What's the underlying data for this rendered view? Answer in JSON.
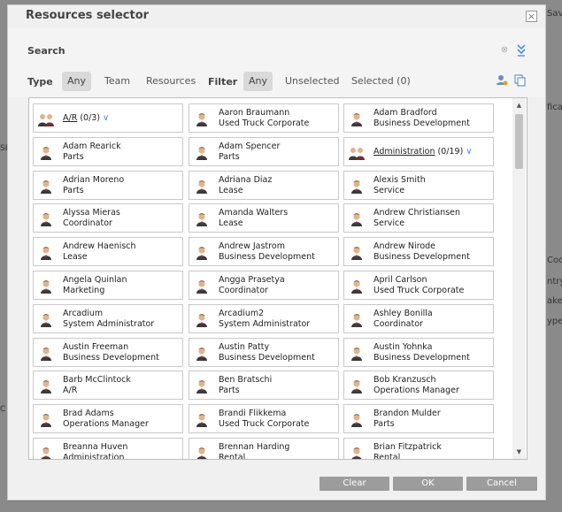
{
  "background": {
    "right_fragments": [
      "Save",
      "fica",
      "Code",
      "ntry",
      "akes",
      "ypes"
    ],
    "left_fragments": [
      "SE",
      "C"
    ]
  },
  "dialog": {
    "title": "Resources selector",
    "close_glyph": "×"
  },
  "search": {
    "label": "Search",
    "clear_glyph": "⊗"
  },
  "type_filter": {
    "label": "Type",
    "options": [
      "Any",
      "Team",
      "Resources"
    ],
    "selected": "Any"
  },
  "state_filter": {
    "label": "Filter",
    "options": [
      "Any",
      "Unselected",
      "Selected (0)"
    ],
    "selected": "Any"
  },
  "cards": [
    {
      "kind": "group",
      "name": "A/R",
      "count": "(0/3)"
    },
    {
      "kind": "person",
      "name": "Aaron Braumann",
      "role": "Used Truck Corporate"
    },
    {
      "kind": "person",
      "name": "Adam Bradford",
      "role": "Business Development"
    },
    {
      "kind": "person",
      "name": "Adam Rearick",
      "role": "Parts"
    },
    {
      "kind": "person",
      "name": "Adam Spencer",
      "role": "Parts"
    },
    {
      "kind": "group",
      "name": "Administration",
      "count": "(0/19)"
    },
    {
      "kind": "person",
      "name": "Adrian Moreno",
      "role": "Parts"
    },
    {
      "kind": "person",
      "name": "Adriana Diaz",
      "role": "Lease"
    },
    {
      "kind": "person",
      "name": "Alexis Smith",
      "role": "Service"
    },
    {
      "kind": "person",
      "name": "Alyssa Mieras",
      "role": "Coordinator"
    },
    {
      "kind": "person",
      "name": "Amanda Walters",
      "role": "Lease"
    },
    {
      "kind": "person",
      "name": "Andrew Christiansen",
      "role": "Service"
    },
    {
      "kind": "person",
      "name": "Andrew Haenisch",
      "role": "Lease"
    },
    {
      "kind": "person",
      "name": "Andrew Jastrom",
      "role": "Business Development"
    },
    {
      "kind": "person",
      "name": "Andrew Nirode",
      "role": "Business Development"
    },
    {
      "kind": "person",
      "name": "Angela Quinlan",
      "role": "Marketing"
    },
    {
      "kind": "person",
      "name": "Angga Prasetya",
      "role": "Coordinator"
    },
    {
      "kind": "person",
      "name": "April Carlson",
      "role": "Used Truck Corporate"
    },
    {
      "kind": "person",
      "name": "Arcadium",
      "role": "System Administrator"
    },
    {
      "kind": "person",
      "name": "Arcadium2",
      "role": "System Administrator"
    },
    {
      "kind": "person",
      "name": "Ashley Bonilla",
      "role": "Coordinator"
    },
    {
      "kind": "person",
      "name": "Austin Freeman",
      "role": "Business Development"
    },
    {
      "kind": "person",
      "name": "Austin Patty",
      "role": "Business Development"
    },
    {
      "kind": "person",
      "name": "Austin Yohnka",
      "role": "Business Development"
    },
    {
      "kind": "person",
      "name": "Barb McClintock",
      "role": "A/R"
    },
    {
      "kind": "person",
      "name": "Ben Bratschi",
      "role": "Parts"
    },
    {
      "kind": "person",
      "name": "Bob Kranzusch",
      "role": "Operations Manager"
    },
    {
      "kind": "person",
      "name": "Brad Adams",
      "role": "Operations Manager"
    },
    {
      "kind": "person",
      "name": "Brandi Flikkema",
      "role": "Used Truck Corporate"
    },
    {
      "kind": "person",
      "name": "Brandon Mulder",
      "role": "Parts"
    },
    {
      "kind": "person",
      "name": "Breanna Huven",
      "role": "Administration"
    },
    {
      "kind": "person",
      "name": "Brennan Harding",
      "role": "Rental"
    },
    {
      "kind": "person",
      "name": "Brian Fitzpatrick",
      "role": "Rental"
    }
  ],
  "buttons": {
    "clear": "Clear",
    "ok": "OK",
    "cancel": "Cancel"
  },
  "colors": {
    "accent": "#4a90e2",
    "button": "#9c9c9c"
  },
  "icons": {
    "person": "person-icon",
    "group": "group-icon",
    "expand": "double-chevron-down-icon",
    "user_settings": "user-settings-icon",
    "copy": "copy-icon"
  }
}
